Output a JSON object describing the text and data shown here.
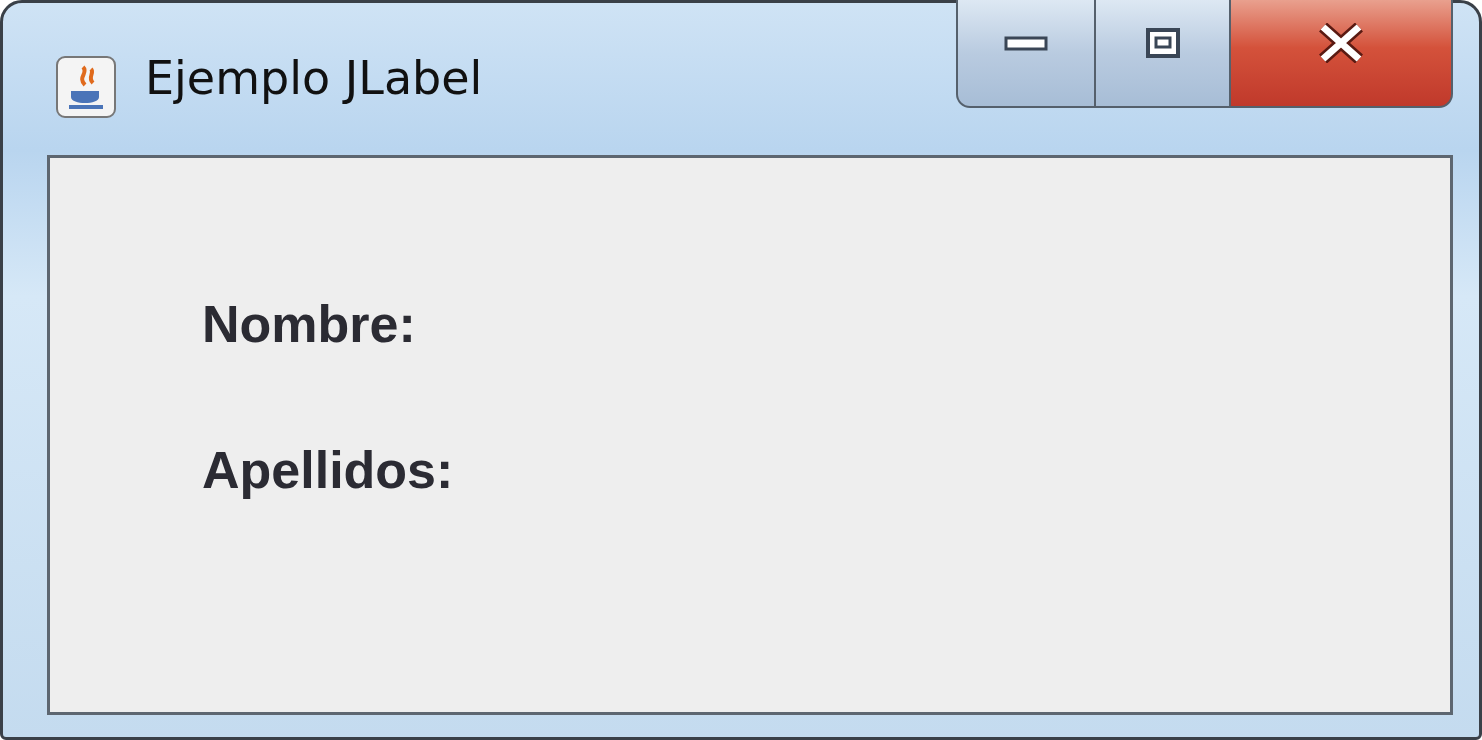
{
  "window": {
    "title": "Ejemplo JLabel"
  },
  "labels": [
    "Nombre:",
    "Apellidos:"
  ]
}
